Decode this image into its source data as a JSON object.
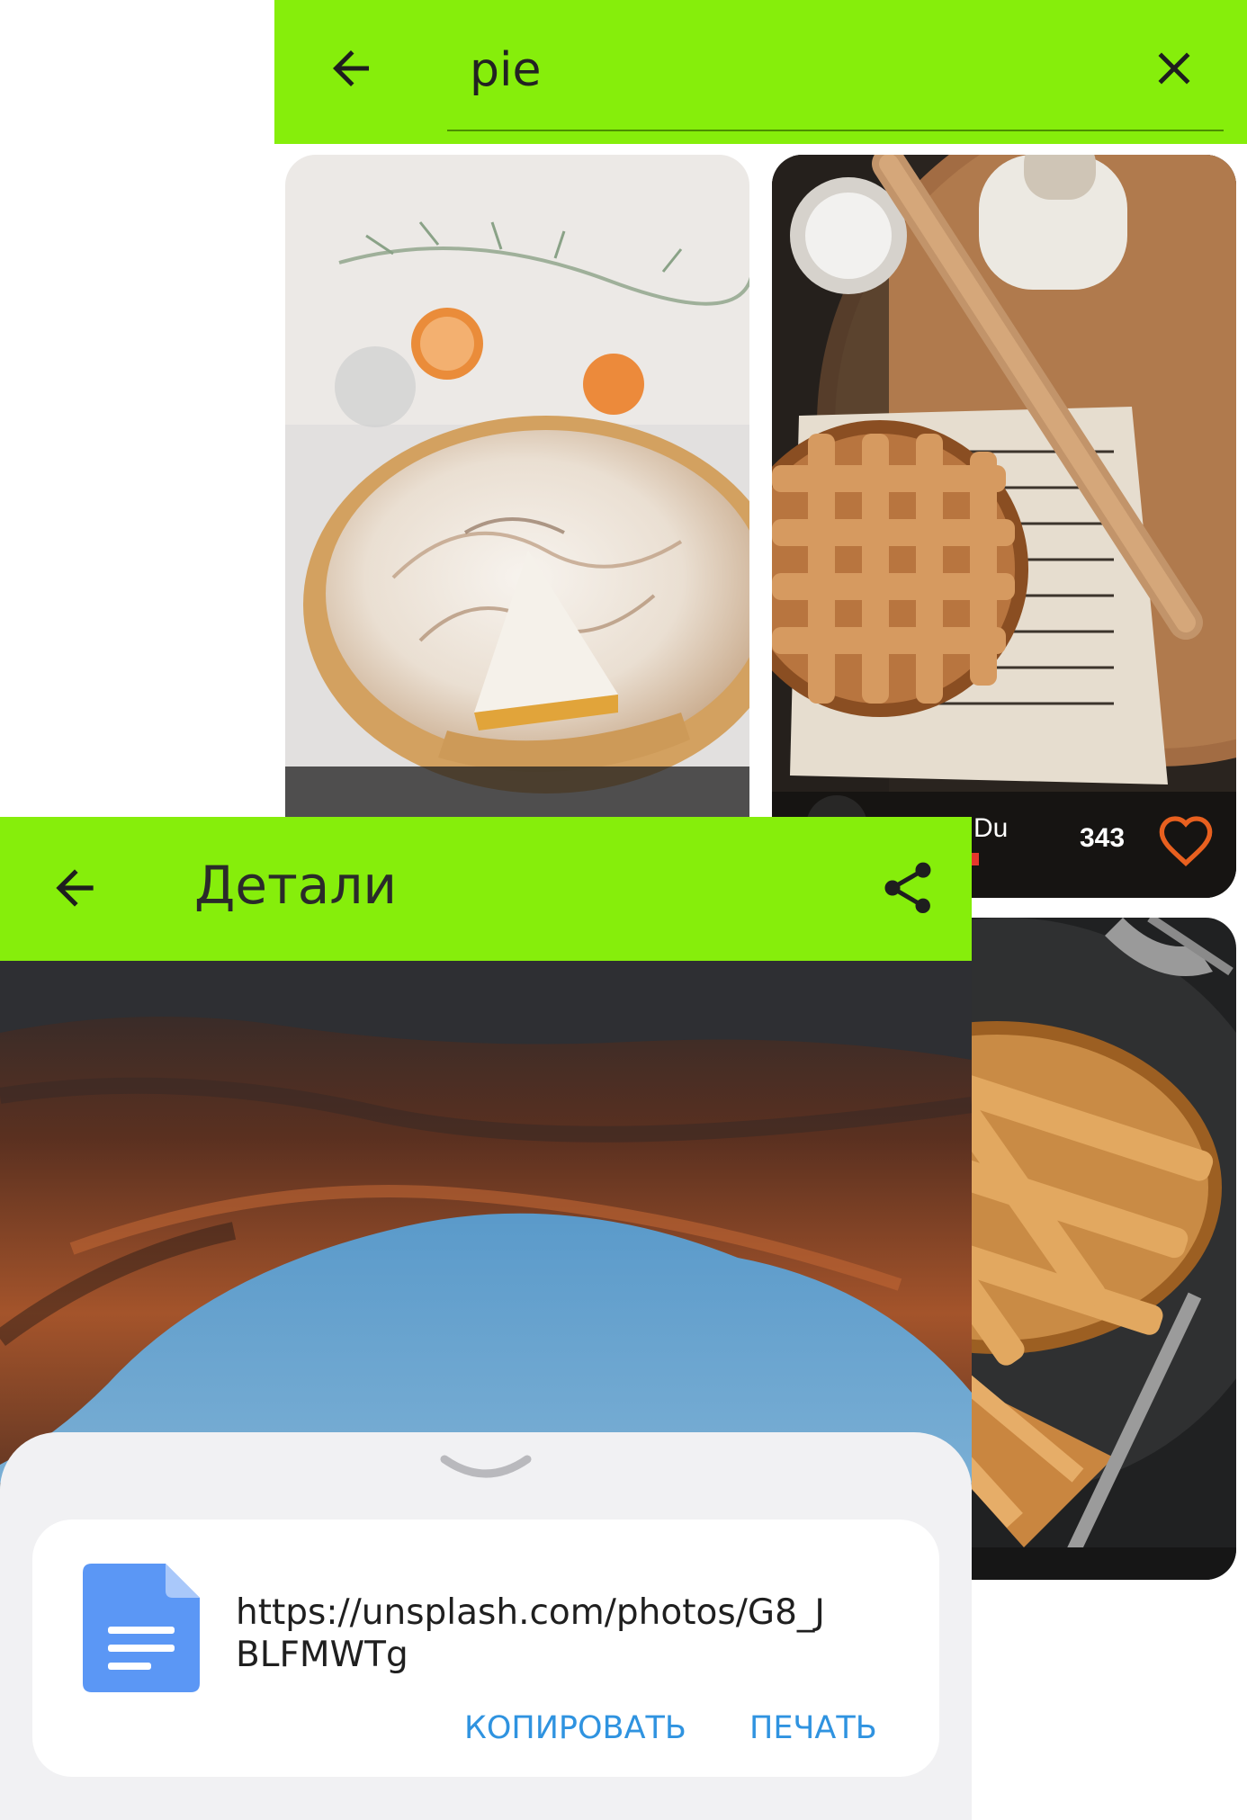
{
  "search_screen": {
    "query": "pie",
    "results": [
      {
        "author": "",
        "likes": ""
      },
      {
        "author": "Du",
        "likes": "343"
      },
      {
        "author": "",
        "likes": ""
      }
    ]
  },
  "details_screen": {
    "title": "Детали"
  },
  "share_sheet": {
    "link": "https://unsplash.com/photos/G8_JBLFMWTg",
    "copy_label": "КОПИРОВАТЬ",
    "print_label": "ПЕЧАТЬ"
  },
  "colors": {
    "accent_bar": "#86ee0b",
    "action_text": "#2f93e0",
    "heart": "#e8601f",
    "doc_icon": "#5b97f5"
  },
  "icons": {
    "back": "arrow-left-icon",
    "clear": "close-icon",
    "share": "share-icon",
    "like": "heart-outline-icon",
    "sheet_handle": "chevron-down-icon",
    "document": "document-icon"
  }
}
